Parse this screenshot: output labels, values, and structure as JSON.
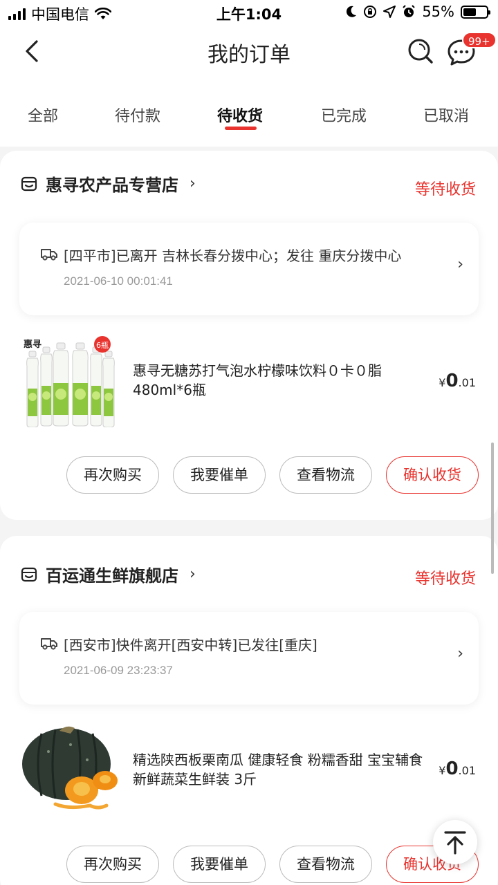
{
  "status_bar": {
    "carrier": "中国电信",
    "time": "上午1:04",
    "battery": "55%",
    "battery_level": 0.55,
    "icons": [
      "signal-icon",
      "wifi-icon",
      "moon-icon",
      "rotation-lock-icon",
      "location-icon",
      "alarm-icon",
      "battery-icon"
    ]
  },
  "nav": {
    "title": "我的订单",
    "badge": "99+",
    "icons": [
      "back-icon",
      "search-icon",
      "message-icon"
    ]
  },
  "tabs": [
    {
      "label": "全部"
    },
    {
      "label": "待付款"
    },
    {
      "label": "待收货",
      "active": true
    },
    {
      "label": "已完成"
    },
    {
      "label": "已取消"
    }
  ],
  "orders": [
    {
      "shop_name": "惠寻农产品专营店",
      "status": "等待收货",
      "logistics": {
        "text": "[四平市]已离开 吉林长春分拨中心；发往 重庆分拨中心",
        "time": "2021-06-10 00:01:41"
      },
      "product": {
        "title": "惠寻无糖苏打气泡水柠檬味饮料０卡０脂480ml*6瓶",
        "price_symbol": "¥",
        "price_int": "0",
        "price_dec": ".01",
        "image_label": "惠寻",
        "image_tag": "6瓶"
      },
      "buttons": [
        "再次购买",
        "我要催单",
        "查看物流",
        "确认收货"
      ]
    },
    {
      "shop_name": "百运通生鲜旗舰店",
      "status": "等待收货",
      "logistics": {
        "text": "[西安市]快件离开[西安中转]已发往[重庆]",
        "time": "2021-06-09 23:23:37"
      },
      "product": {
        "title": "精选陕西板栗南瓜 健康轻食 粉糯香甜 宝宝辅食 新鲜蔬菜生鲜装 3斤",
        "price_symbol": "¥",
        "price_int": "0",
        "price_dec": ".01"
      },
      "buttons": [
        "再次购买",
        "我要催单",
        "查看物流",
        "确认收货"
      ]
    }
  ],
  "colors": {
    "accent": "#e8332e",
    "background": "#f4f4f4"
  }
}
